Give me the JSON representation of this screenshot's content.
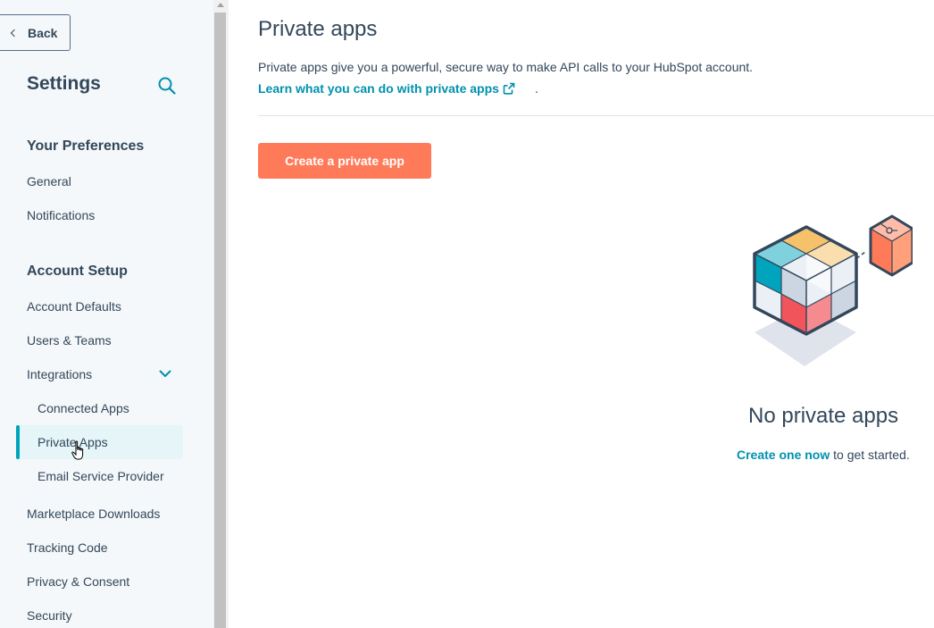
{
  "sidebar": {
    "back_label": "Back",
    "title": "Settings",
    "search_icon": "search-icon",
    "sections": {
      "preferences": {
        "heading": "Your Preferences",
        "general": "General",
        "notifications": "Notifications"
      },
      "account_setup": {
        "heading": "Account Setup",
        "account_defaults": "Account Defaults",
        "users_teams": "Users & Teams",
        "integrations": "Integrations",
        "connected_apps": "Connected Apps",
        "private_apps": "Private Apps",
        "email_service_provider": "Email Service Provider",
        "marketplace_downloads": "Marketplace Downloads",
        "tracking_code": "Tracking Code",
        "privacy_consent": "Privacy & Consent",
        "security": "Security"
      }
    },
    "active_item": "Private Apps"
  },
  "main": {
    "title": "Private apps",
    "description": "Private apps give you a powerful, secure way to make API calls to your HubSpot account.",
    "learn_link": "Learn what you can do with private apps",
    "learn_suffix": ".",
    "create_button": "Create a private app",
    "empty_state": {
      "title": "No private apps",
      "link": "Create one now",
      "suffix": " to get started."
    }
  },
  "colors": {
    "accent": "#0091ae",
    "primary_button": "#ff7a59",
    "active_bar": "#00a4bd",
    "text": "#33475b"
  }
}
